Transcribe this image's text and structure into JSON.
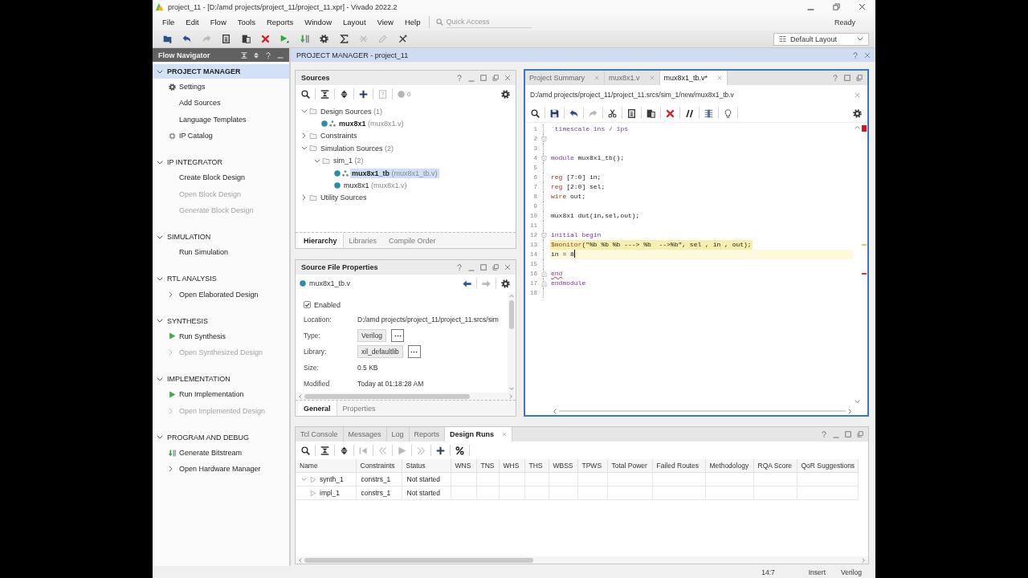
{
  "window": {
    "title": "project_11 - [D:/amd projects/project_11/project_11.xpr] - Vivado 2022.2"
  },
  "menu": {
    "items": [
      "File",
      "Edit",
      "Flow",
      "Tools",
      "Reports",
      "Window",
      "Layout",
      "View",
      "Help"
    ],
    "quick_access": {
      "placeholder": "Quick Access"
    },
    "status": "Ready"
  },
  "toolbar": {
    "buttons": [
      {
        "kind": "open",
        "disabled": false
      },
      {
        "kind": "undo",
        "disabled": false
      },
      {
        "kind": "redo",
        "disabled": true
      },
      {
        "kind": "copy",
        "disabled": false
      },
      {
        "kind": "paste",
        "disabled": false
      },
      {
        "kind": "delete",
        "disabled": false
      },
      {
        "kind": "run",
        "disabled": false
      },
      {
        "kind": "bitstream",
        "disabled": false
      },
      {
        "kind": "settings",
        "disabled": false
      },
      {
        "kind": "report",
        "disabled": false
      },
      {
        "kind": "cross",
        "disabled": true
      },
      {
        "kind": "pencil",
        "disabled": true
      },
      {
        "kind": "tools",
        "disabled": false
      }
    ],
    "layout": "Default Layout"
  },
  "flow_navigator": {
    "title": "Flow Navigator",
    "sections": [
      {
        "title": "PROJECT MANAGER",
        "expanded": true,
        "selected": true,
        "items": [
          {
            "label": "Settings",
            "kind": "settings",
            "disabled": false
          },
          {
            "label": "Add Sources",
            "kind": "plain",
            "disabled": false
          },
          {
            "label": "Language Templates",
            "kind": "plain",
            "disabled": false
          },
          {
            "label": "IP Catalog",
            "kind": "ip",
            "disabled": false
          }
        ]
      },
      {
        "title": "IP INTEGRATOR",
        "expanded": true,
        "selected": false,
        "items": [
          {
            "label": "Create Block Design",
            "kind": "plain",
            "disabled": false
          },
          {
            "label": "Open Block Design",
            "kind": "plain",
            "disabled": true
          },
          {
            "label": "Generate Block Design",
            "kind": "plain",
            "disabled": true
          }
        ]
      },
      {
        "title": "SIMULATION",
        "expanded": true,
        "selected": false,
        "items": [
          {
            "label": "Run Simulation",
            "kind": "plain",
            "disabled": false
          }
        ]
      },
      {
        "title": "RTL ANALYSIS",
        "expanded": true,
        "selected": false,
        "items": [
          {
            "label": "Open Elaborated Design",
            "kind": "expandable",
            "disabled": false
          }
        ]
      },
      {
        "title": "SYNTHESIS",
        "expanded": true,
        "selected": false,
        "items": [
          {
            "label": "Run Synthesis",
            "kind": "run",
            "disabled": false
          },
          {
            "label": "Open Synthesized Design",
            "kind": "expandable",
            "disabled": true
          }
        ]
      },
      {
        "title": "IMPLEMENTATION",
        "expanded": true,
        "selected": false,
        "items": [
          {
            "label": "Run Implementation",
            "kind": "run",
            "disabled": false
          },
          {
            "label": "Open Implemented Design",
            "kind": "expandable",
            "disabled": true
          }
        ]
      },
      {
        "title": "PROGRAM AND DEBUG",
        "expanded": true,
        "selected": false,
        "items": [
          {
            "label": "Generate Bitstream",
            "kind": "bitstream",
            "disabled": false
          },
          {
            "label": "Open Hardware Manager",
            "kind": "expandable",
            "disabled": false
          }
        ]
      }
    ]
  },
  "project_manager": {
    "title": "PROJECT MANAGER - project_11"
  },
  "sources": {
    "title": "Sources",
    "toolbar": [
      {
        "kind": "search",
        "disabled": false
      },
      {
        "kind": "collapse",
        "disabled": false
      },
      {
        "kind": "expand",
        "disabled": false
      },
      {
        "kind": "add",
        "disabled": false
      },
      {
        "kind": "file_help",
        "disabled": true
      },
      {
        "kind": "settings",
        "disabled": false
      }
    ],
    "message_count": "0",
    "tree": [
      {
        "kind": "folder",
        "label": "Design Sources",
        "count": "(1)",
        "expanded": true,
        "selected": false,
        "children": [
          {
            "kind": "module",
            "name": "mux8x1",
            "file": "(mux8x1.v)",
            "top": true,
            "selected": false
          }
        ]
      },
      {
        "kind": "folder",
        "label": "Constraints",
        "expanded": false,
        "selected": false
      },
      {
        "kind": "folder",
        "label": "Simulation Sources",
        "count": "(2)",
        "expanded": true,
        "selected": false,
        "children": [
          {
            "kind": "folder",
            "label": "sim_1",
            "count": "(2)",
            "expanded": true,
            "selected": false,
            "children": [
              {
                "kind": "module",
                "name": "mux8x1_tb",
                "file": "(mux8x1_tb.v)",
                "top": true,
                "selected": true
              },
              {
                "kind": "module",
                "name": "mux8x1",
                "file": "(mux8x1.v)",
                "top": false,
                "selected": false
              }
            ]
          }
        ]
      },
      {
        "kind": "folder",
        "label": "Utility Sources",
        "expanded": false,
        "selected": false
      }
    ],
    "tabs": [
      {
        "label": "Hierarchy",
        "selected": true
      },
      {
        "label": "Libraries",
        "selected": false
      },
      {
        "label": "Compile Order",
        "selected": false
      }
    ]
  },
  "file_properties": {
    "title": "Source File Properties",
    "file": "mux8x1_tb.v",
    "nav": [
      {
        "kind": "back",
        "disabled": false
      },
      {
        "kind": "forward",
        "disabled": true
      },
      {
        "kind": "settings",
        "disabled": false
      }
    ],
    "enabled": {
      "label": "Enabled",
      "checked": true
    },
    "fields": [
      {
        "label": "Location:",
        "kind": "text",
        "value": "D:/amd projects/project_11/project_11.srcs/sim"
      },
      {
        "label": "Type:",
        "kind": "choice",
        "value": "Verilog"
      },
      {
        "label": "Library:",
        "kind": "choice",
        "value": "xil_defaultlib"
      },
      {
        "label": "Size:",
        "kind": "text",
        "value": "0.5 KB"
      },
      {
        "label": "Modified",
        "kind": "text",
        "value": "Today at 01:18:28 AM"
      }
    ],
    "tabs": [
      {
        "label": "General",
        "selected": true
      },
      {
        "label": "Properties",
        "selected": false
      }
    ]
  },
  "editor": {
    "tabs": [
      {
        "label": "Project Summary",
        "selected": false
      },
      {
        "label": "mux8x1.v",
        "selected": false
      },
      {
        "label": "mux8x1_tb.v*",
        "selected": true
      }
    ],
    "path": "D:/amd projects/project_11/project_11.srcs/sim_1/new/mux8x1_tb.v",
    "toolbar": [
      {
        "kind": "search",
        "disabled": false
      },
      {
        "kind": "save",
        "disabled": false
      },
      {
        "kind": "undo",
        "disabled": false
      },
      {
        "kind": "redo",
        "disabled": true
      },
      {
        "kind": "cut",
        "disabled": false
      },
      {
        "kind": "copy",
        "disabled": false
      },
      {
        "kind": "paste",
        "disabled": false
      },
      {
        "kind": "delete",
        "disabled": false
      },
      {
        "kind": "comment",
        "disabled": false
      },
      {
        "kind": "indent",
        "disabled": false
      },
      {
        "kind": "hint",
        "disabled": false
      },
      {
        "kind": "settings",
        "disabled": false
      }
    ],
    "lines": [
      {
        "number": "1",
        "kind": "plain",
        "tokens": [
          {
            "kind": "directive",
            "text": "`timescale 1ns / 1ps"
          }
        ],
        "current": false,
        "marked": false,
        "error": false
      },
      {
        "number": "2",
        "kind": "fold_start",
        "current": false,
        "marked": false,
        "error": false
      },
      {
        "number": "3",
        "kind": "plain",
        "current": false,
        "marked": false,
        "error": false
      },
      {
        "number": "4",
        "kind": "fold_start",
        "tokens": [
          {
            "kind": "keyword",
            "text": "module"
          },
          {
            "kind": "plain",
            "text": " mux8x1_tb();"
          }
        ],
        "current": false,
        "marked": false,
        "error": false
      },
      {
        "number": "5",
        "kind": "plain",
        "current": false,
        "marked": false,
        "error": false
      },
      {
        "number": "6",
        "kind": "plain",
        "tokens": [
          {
            "kind": "type",
            "text": "reg"
          },
          {
            "kind": "plain",
            "text": " [7:0] in;"
          }
        ],
        "current": false,
        "marked": false,
        "error": false
      },
      {
        "number": "7",
        "kind": "plain",
        "tokens": [
          {
            "kind": "type",
            "text": "reg"
          },
          {
            "kind": "plain",
            "text": " [2:0] sel;"
          }
        ],
        "current": false,
        "marked": false,
        "error": false
      },
      {
        "number": "8",
        "kind": "plain",
        "tokens": [
          {
            "kind": "type",
            "text": "wire"
          },
          {
            "kind": "plain",
            "text": " out;"
          }
        ],
        "current": false,
        "marked": false,
        "error": false
      },
      {
        "number": "9",
        "kind": "plain",
        "current": false,
        "marked": false,
        "error": false
      },
      {
        "number": "10",
        "kind": "plain",
        "tokens": [
          {
            "kind": "plain",
            "text": "mux8x1 dut(in,sel,out);"
          }
        ],
        "current": false,
        "marked": false,
        "error": false
      },
      {
        "number": "11",
        "kind": "plain",
        "current": false,
        "marked": false,
        "error": false
      },
      {
        "number": "12",
        "kind": "fold_start",
        "tokens": [
          {
            "kind": "keyword",
            "text": "initial begin"
          }
        ],
        "current": false,
        "marked": false,
        "error": false
      },
      {
        "number": "13",
        "kind": "plain",
        "tokens": [
          {
            "kind": "system",
            "text": "$monitor"
          },
          {
            "kind": "plain",
            "text": "(\"%b %b %b ---> %b  -->%b\", sel , in , out);"
          }
        ],
        "current": false,
        "marked": true,
        "error": false
      },
      {
        "number": "14",
        "kind": "plain",
        "tokens": [
          {
            "kind": "plain",
            "text": "in = 8"
          }
        ],
        "current": true,
        "marked": false,
        "error": false
      },
      {
        "number": "15",
        "kind": "plain",
        "current": false,
        "marked": false,
        "error": false
      },
      {
        "number": "16",
        "kind": "fold_end",
        "tokens": [
          {
            "kind": "keyword",
            "text": "end"
          }
        ],
        "current": false,
        "marked": false,
        "error": true
      },
      {
        "number": "17",
        "kind": "fold_end",
        "tokens": [
          {
            "kind": "keyword",
            "text": "endmodule"
          }
        ],
        "current": false,
        "marked": false,
        "error": false
      },
      {
        "number": "18",
        "kind": "plain",
        "current": false,
        "marked": false,
        "error": false
      }
    ]
  },
  "runs": {
    "tabs": [
      {
        "label": "Tcl Console",
        "selected": false
      },
      {
        "label": "Messages",
        "selected": false
      },
      {
        "label": "Log",
        "selected": false
      },
      {
        "label": "Reports",
        "selected": false
      },
      {
        "label": "Design Runs",
        "selected": true
      }
    ],
    "toolbar": [
      {
        "kind": "search",
        "disabled": false
      },
      {
        "kind": "collapse",
        "disabled": false
      },
      {
        "kind": "expand",
        "disabled": false
      },
      {
        "kind": "first",
        "disabled": true
      },
      {
        "kind": "rewind",
        "disabled": true
      },
      {
        "kind": "launch",
        "disabled": true
      },
      {
        "kind": "forward_all",
        "disabled": true
      },
      {
        "kind": "add",
        "disabled": false
      },
      {
        "kind": "percent",
        "disabled": false
      }
    ],
    "columns": [
      "Name",
      "Constraints",
      "Status",
      "WNS",
      "TNS",
      "WHS",
      "THS",
      "WBSS",
      "TPWS",
      "Total Power",
      "Failed Routes",
      "Methodology",
      "RQA Score",
      "QoR Suggestions"
    ],
    "rows": [
      {
        "name": "synth_1",
        "constraints": "constrs_1",
        "status": "Not started",
        "expanded": true,
        "selected": false,
        "children": [
          {
            "name": "impl_1",
            "constraints": "constrs_1",
            "status": "Not started",
            "selected": false
          }
        ]
      }
    ]
  },
  "status_bar": {
    "position": "14:7",
    "mode": "Insert",
    "language": "Verilog"
  }
}
